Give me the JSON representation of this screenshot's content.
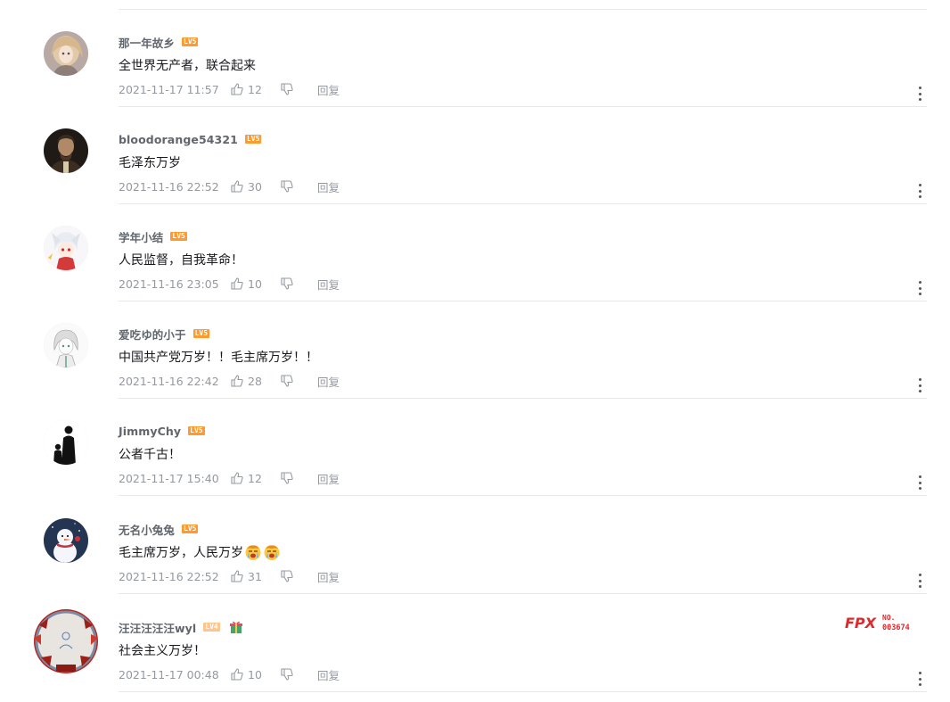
{
  "comments": [
    {
      "username": "那一年故乡",
      "level": "LV5",
      "content": "全世界无产者，联合起来",
      "time": "2021-11-17 11:57",
      "likes": "12",
      "reply": "回复",
      "avatar": "anime-girl-avatar"
    },
    {
      "username": "bloodorange54321",
      "level": "LV5",
      "content": "毛泽东万岁",
      "time": "2021-11-16 22:52",
      "likes": "30",
      "reply": "回复",
      "avatar": "portrait-avatar"
    },
    {
      "username": "学年小结",
      "level": "LV5",
      "content": "人民监督，自我革命！",
      "time": "2021-11-16 23:05",
      "likes": "10",
      "reply": "回复",
      "avatar": "anime-character-avatar"
    },
    {
      "username": "爱吃ゆ的小于",
      "level": "LV5",
      "content": "中国共产党万岁！！毛主席万岁！！",
      "time": "2021-11-16 22:42",
      "likes": "28",
      "reply": "回复",
      "avatar": "sketch-character-avatar"
    },
    {
      "username": "JimmyChy",
      "level": "LV5",
      "content": "公者千古！",
      "time": "2021-11-17 15:40",
      "likes": "12",
      "reply": "回复",
      "avatar": "silhouette-avatar"
    },
    {
      "username": "无名小兔兔",
      "level": "LV5",
      "content": "毛主席万岁，人民万岁",
      "emojis": [
        "crying-emoji",
        "crying-emoji"
      ],
      "time": "2021-11-16 22:52",
      "likes": "31",
      "reply": "回复",
      "avatar": "snowman-avatar"
    },
    {
      "username": "汪汪汪汪汪wyl",
      "level": "LV4",
      "content": "社会主义万岁！",
      "time": "2021-11-17 00:48",
      "likes": "10",
      "reply": "回复",
      "avatar": "framed-avatar",
      "badge": {
        "team": "FPX",
        "label": "NO.",
        "number": "003674"
      }
    }
  ],
  "colors": {
    "level_badge": "#ff9a2e",
    "username": "#61666d",
    "meta": "#9499a0",
    "fpx_red": "#e3262a"
  }
}
